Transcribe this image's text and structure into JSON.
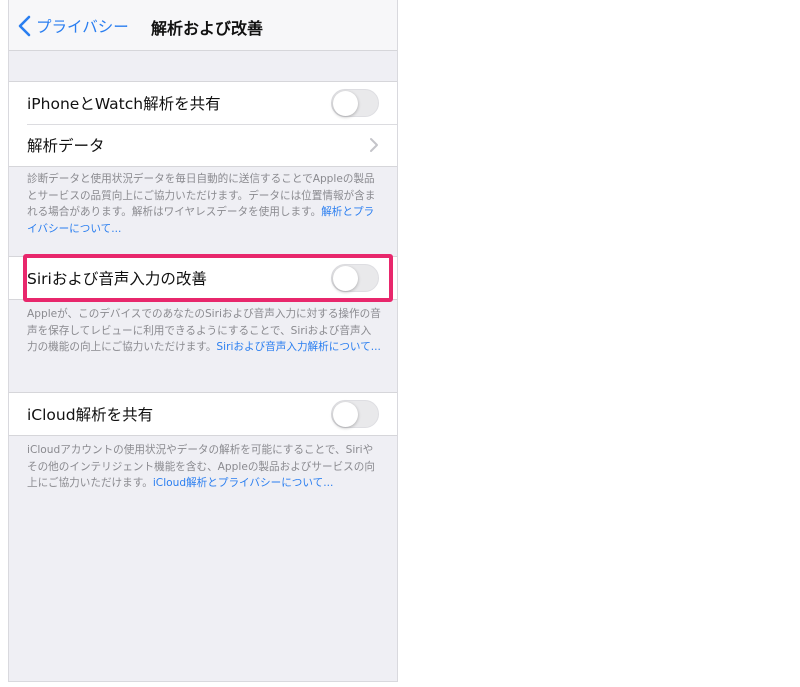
{
  "navbar": {
    "back_label": "プライバシー",
    "title": "解析および改善"
  },
  "sections": {
    "share_iphone_watch": {
      "label": "iPhoneとWatch解析を共有",
      "on": false
    },
    "analytics_data": {
      "label": "解析データ"
    },
    "footer1_text": "診断データと使用状況データを毎日自動的に送信することでAppleの製品とサービスの品質向上にご協力いただけます。データには位置情報が含まれる場合があります。解析はワイヤレスデータを使用します。",
    "footer1_link": "解析とプライバシーについて...",
    "siri_improve": {
      "label": "Siriおよび音声入力の改善",
      "on": false
    },
    "footer2_text": "Appleが、このデバイスでのあなたのSiriおよび音声入力に対する操作の音声を保存してレビューに利用できるようにすることで、Siriおよび音声入力の機能の向上にご協力いただけます。",
    "footer2_link": "Siriおよび音声入力解析について...",
    "icloud_share": {
      "label": "iCloud解析を共有",
      "on": false
    },
    "footer3_text": "iCloudアカウントの使用状況やデータの解析を可能にすることで、Siriやその他のインテリジェント機能を含む、Appleの製品およびサービスの向上にご協力いただけます。",
    "footer3_link": "iCloud解析とプライバシーについて..."
  },
  "colors": {
    "accent": "#2a7ef0",
    "highlight": "#e8276c",
    "background": "#efeff4"
  },
  "icons": {
    "back": "chevron-left-icon",
    "disclosure": "chevron-right-icon"
  }
}
